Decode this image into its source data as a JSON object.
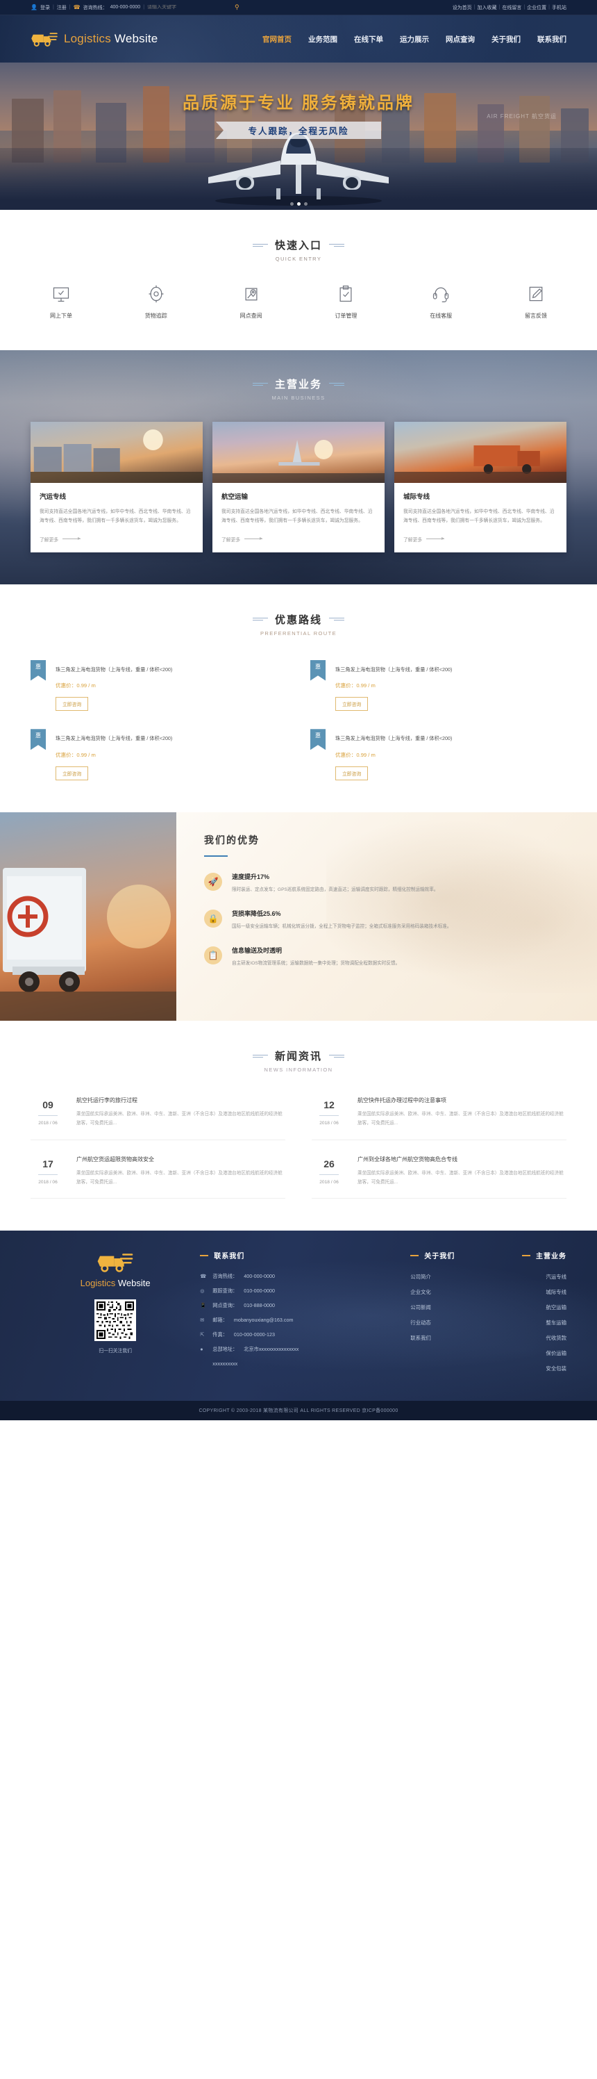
{
  "colors": {
    "accent": "#e8a33d",
    "navy": "#1e2b49",
    "blue": "#5b93b5",
    "rule": "#3f7fb5"
  },
  "topbar": {
    "login": "登录",
    "sep": "|",
    "register": "注册",
    "hotline_label": "咨询热线：",
    "hotline": "400-000-0000",
    "search_placeholder": "请输入关键字",
    "search_icon": "search-icon",
    "user_icon": "user-icon",
    "phone_icon": "phone-icon",
    "right_links": [
      "设为首页",
      "加入收藏",
      "在线留言",
      "企业位置",
      "手机站"
    ]
  },
  "header": {
    "brand_1": "Logistics",
    "brand_2": "Website",
    "logo_icon": "truck-icon",
    "nav": [
      {
        "label": "官网首页",
        "active": true
      },
      {
        "label": "业务范围",
        "active": false
      },
      {
        "label": "在线下单",
        "active": false
      },
      {
        "label": "运力展示",
        "active": false
      },
      {
        "label": "网点查询",
        "active": false
      },
      {
        "label": "关于我们",
        "active": false
      },
      {
        "label": "联系我们",
        "active": false
      }
    ]
  },
  "hero": {
    "title": "品质源于专业  服务铸就品牌",
    "subtitle": "专人跟踪，全程无风险",
    "badge": "AIR FREIGHT 航空货运",
    "dots": 3,
    "active_dot": 1
  },
  "quick": {
    "title": "快速入口",
    "subtitle": "QUICK ENTRY",
    "items": [
      {
        "label": "网上下单",
        "icon": "monitor-check-icon"
      },
      {
        "label": "货物追踪",
        "icon": "target-icon"
      },
      {
        "label": "网点查阅",
        "icon": "map-pin-icon"
      },
      {
        "label": "订单管理",
        "icon": "clipboard-check-icon"
      },
      {
        "label": "在线客服",
        "icon": "headset-icon"
      },
      {
        "label": "留言反馈",
        "icon": "pencil-note-icon"
      }
    ]
  },
  "business": {
    "title": "主营业务",
    "subtitle": "MAIN BUSINESS",
    "more_label": "了解更多",
    "cards": [
      {
        "title": "汽运专线",
        "desc": "我司支持直达全国各地汽运专线，如华中专线、西北专线、华南专线、沿海专线、西南专线等，我们拥有一千多辆长途货车，竭诚为您服务。",
        "image": "truck-fleet-photo"
      },
      {
        "title": "航空运输",
        "desc": "我司支持直达全国各地汽运专线，如华中专线、西北专线、华南专线、沿海专线、西南专线等，我们拥有一千多辆长途货车，竭诚为您服务。",
        "image": "airplane-photo"
      },
      {
        "title": "城际专线",
        "desc": "我司支持直达全国各地汽运专线，如华中专线、西北专线、华南专线、沿海专线、西南专线等，我们拥有一千多辆长途货车，竭诚为您服务。",
        "image": "cargo-truck-photo"
      }
    ]
  },
  "routes": {
    "title": "优惠路线",
    "subtitle": "PREFERENTIAL ROUTE",
    "ribbon_text": "惠",
    "items": [
      {
        "name": "珠三角发上海电泡货物（上海专线，重量 / 体积<200)",
        "price_label": "优惠价：",
        "price": "0.99 / m",
        "btn": "立即咨询"
      },
      {
        "name": "珠三角发上海电泡货物（上海专线，重量 / 体积<200)",
        "price_label": "优惠价：",
        "price": "0.99 / m",
        "btn": "立即咨询"
      },
      {
        "name": "珠三角发上海电泡货物（上海专线，重量 / 体积<200)",
        "price_label": "优惠价：",
        "price": "0.99 / m",
        "btn": "立即咨询"
      },
      {
        "name": "珠三角发上海电泡货物（上海专线，重量 / 体积<200)",
        "price_label": "优惠价：",
        "price": "0.99 / m",
        "btn": "立即咨询"
      }
    ]
  },
  "advantage": {
    "title": "我们的优势",
    "photo": "truck-sunset-photo",
    "items": [
      {
        "icon": "rocket-icon",
        "heading": "速度提升17%",
        "desc": "限时装运、定点发车；GPS巡航系统固定路由，高速直达；运输调度实时跟踪，精细化控制运输效率。"
      },
      {
        "icon": "lock-icon",
        "heading": "货损率降低25.6%",
        "desc": "国际一级安全运输车辆；机械化转运分拨，全程上下货物电子监控；全箱式标准服务采用格码装箱技术标准。"
      },
      {
        "icon": "document-icon",
        "heading": "信息输送及时透明",
        "desc": "自主研发IOS物流管理系统；运输数据统一集中处理；货物调配全程数据实时反馈。"
      }
    ]
  },
  "news": {
    "title": "新闻资讯",
    "subtitle": "NEWS INFORMATION",
    "items": [
      {
        "day": "09",
        "ym": "2018 / 06",
        "title": "航空托运行李的旅行过程",
        "desc": "乘坐国航实际承运美洲、欧洲、非洲、中东、澳新、亚洲（不含日本）及港澳台地区航线航班的经济舱旅客，可免费托运..."
      },
      {
        "day": "12",
        "ym": "2018 / 06",
        "title": "航空快件托运办理过程中的注意事项",
        "desc": "乘坐国航实际承运美洲、欧洲、非洲、中东、澳新、亚洲（不含日本）及港澳台地区航线航班的经济舱旅客，可免费托运..."
      },
      {
        "day": "17",
        "ym": "2018 / 06",
        "title": "广州航空货运超限货物高效安全",
        "desc": "乘坐国航实际承运美洲、欧洲、非洲、中东、澳新、亚洲（不含日本）及港澳台地区航线航班的经济舱旅客，可免费托运..."
      },
      {
        "day": "26",
        "ym": "2018 / 06",
        "title": "广州到全球各地广州航空货物高危合专线",
        "desc": "乘坐国航实际承运美洲、欧洲、非洲、中东、澳新、亚洲（不含日本）及港澳台地区航线航班的经济舱旅客，可免费托运..."
      }
    ]
  },
  "footer": {
    "brand_1": "Logistics",
    "brand_2": "Website",
    "logo_icon": "truck-icon",
    "qr_label": "扫一扫关注我们",
    "contact": {
      "heading": "联系我们",
      "rows": [
        {
          "icon": "phone-icon",
          "label": "咨询热线：",
          "value": "400-000-0000"
        },
        {
          "icon": "target-icon",
          "label": "跟踪查询：",
          "value": "010-000-0000"
        },
        {
          "icon": "mobile-icon",
          "label": "网点查询：",
          "value": "010-888-0000"
        },
        {
          "icon": "mail-icon",
          "label": "邮箱：",
          "value": "mobanyouxiang@163.com"
        },
        {
          "icon": "fax-icon",
          "label": "传真：",
          "value": "010-000-0000-123"
        },
        {
          "icon": "pin-icon",
          "label": "总部地址：",
          "value": "北京市xxxxxxxxxxxxxxxx"
        },
        {
          "icon": "blank-icon",
          "label": "",
          "value": "xxxxxxxxxx"
        }
      ]
    },
    "about": {
      "heading": "关于我们",
      "links": [
        "公司简介",
        "企业文化",
        "公司新闻",
        "行业动态",
        "联系我们"
      ]
    },
    "business": {
      "heading": "主营业务",
      "links": [
        "汽运专线",
        "城际专线",
        "航空运输",
        "整车运输",
        "代收货款",
        "保价运输",
        "安全包装"
      ]
    },
    "copyright": "COPYRIGHT © 2003-2018 某物流有限公司  ALL RIGHTS RESERVED  京ICP备000000"
  }
}
